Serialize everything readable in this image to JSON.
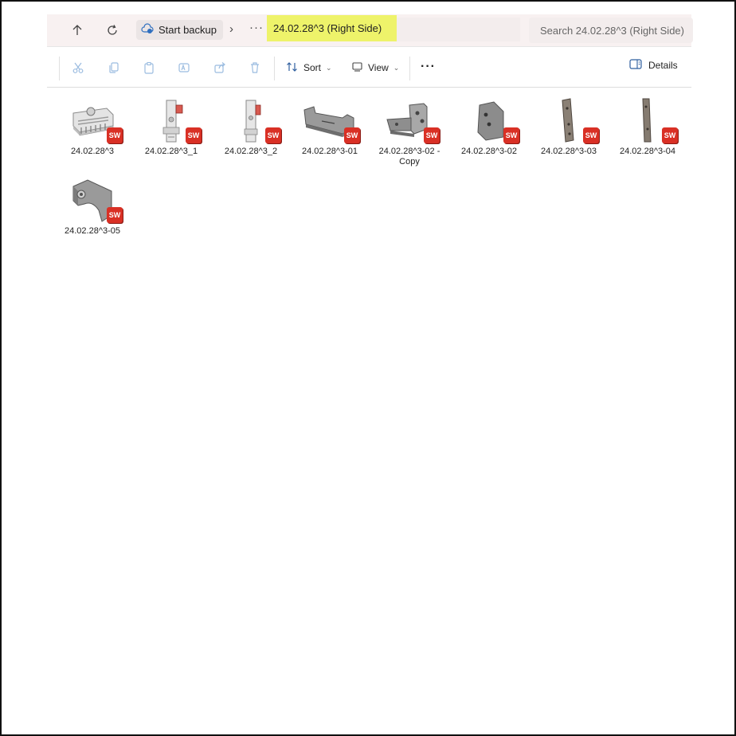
{
  "addressbar": {
    "backup_label": "Start backup",
    "more": "···",
    "current_folder": "24.02.28^3 (Right Side)",
    "search_placeholder": "Search 24.02.28^3 (Right Side)"
  },
  "toolbar": {
    "sort_label": "Sort",
    "view_label": "View",
    "more": "···",
    "details_label": "Details"
  },
  "files": [
    {
      "name": "24.02.28^3",
      "shape": "assembly"
    },
    {
      "name": "24.02.28^3_1",
      "shape": "tall-assembly"
    },
    {
      "name": "24.02.28^3_2",
      "shape": "tall-assembly"
    },
    {
      "name": "24.02.28^3-01",
      "shape": "channel"
    },
    {
      "name": "24.02.28^3-02 - Copy",
      "shape": "bracket"
    },
    {
      "name": "24.02.28^3-02",
      "shape": "plate"
    },
    {
      "name": "24.02.28^3-03",
      "shape": "bar"
    },
    {
      "name": "24.02.28^3-04",
      "shape": "bar"
    },
    {
      "name": "24.02.28^3-05",
      "shape": "clamp"
    }
  ],
  "badge_text": "SW",
  "colors": {
    "highlight": "#eef36a",
    "badge": "#d93025",
    "disabled_icon": "#9bbce0"
  }
}
